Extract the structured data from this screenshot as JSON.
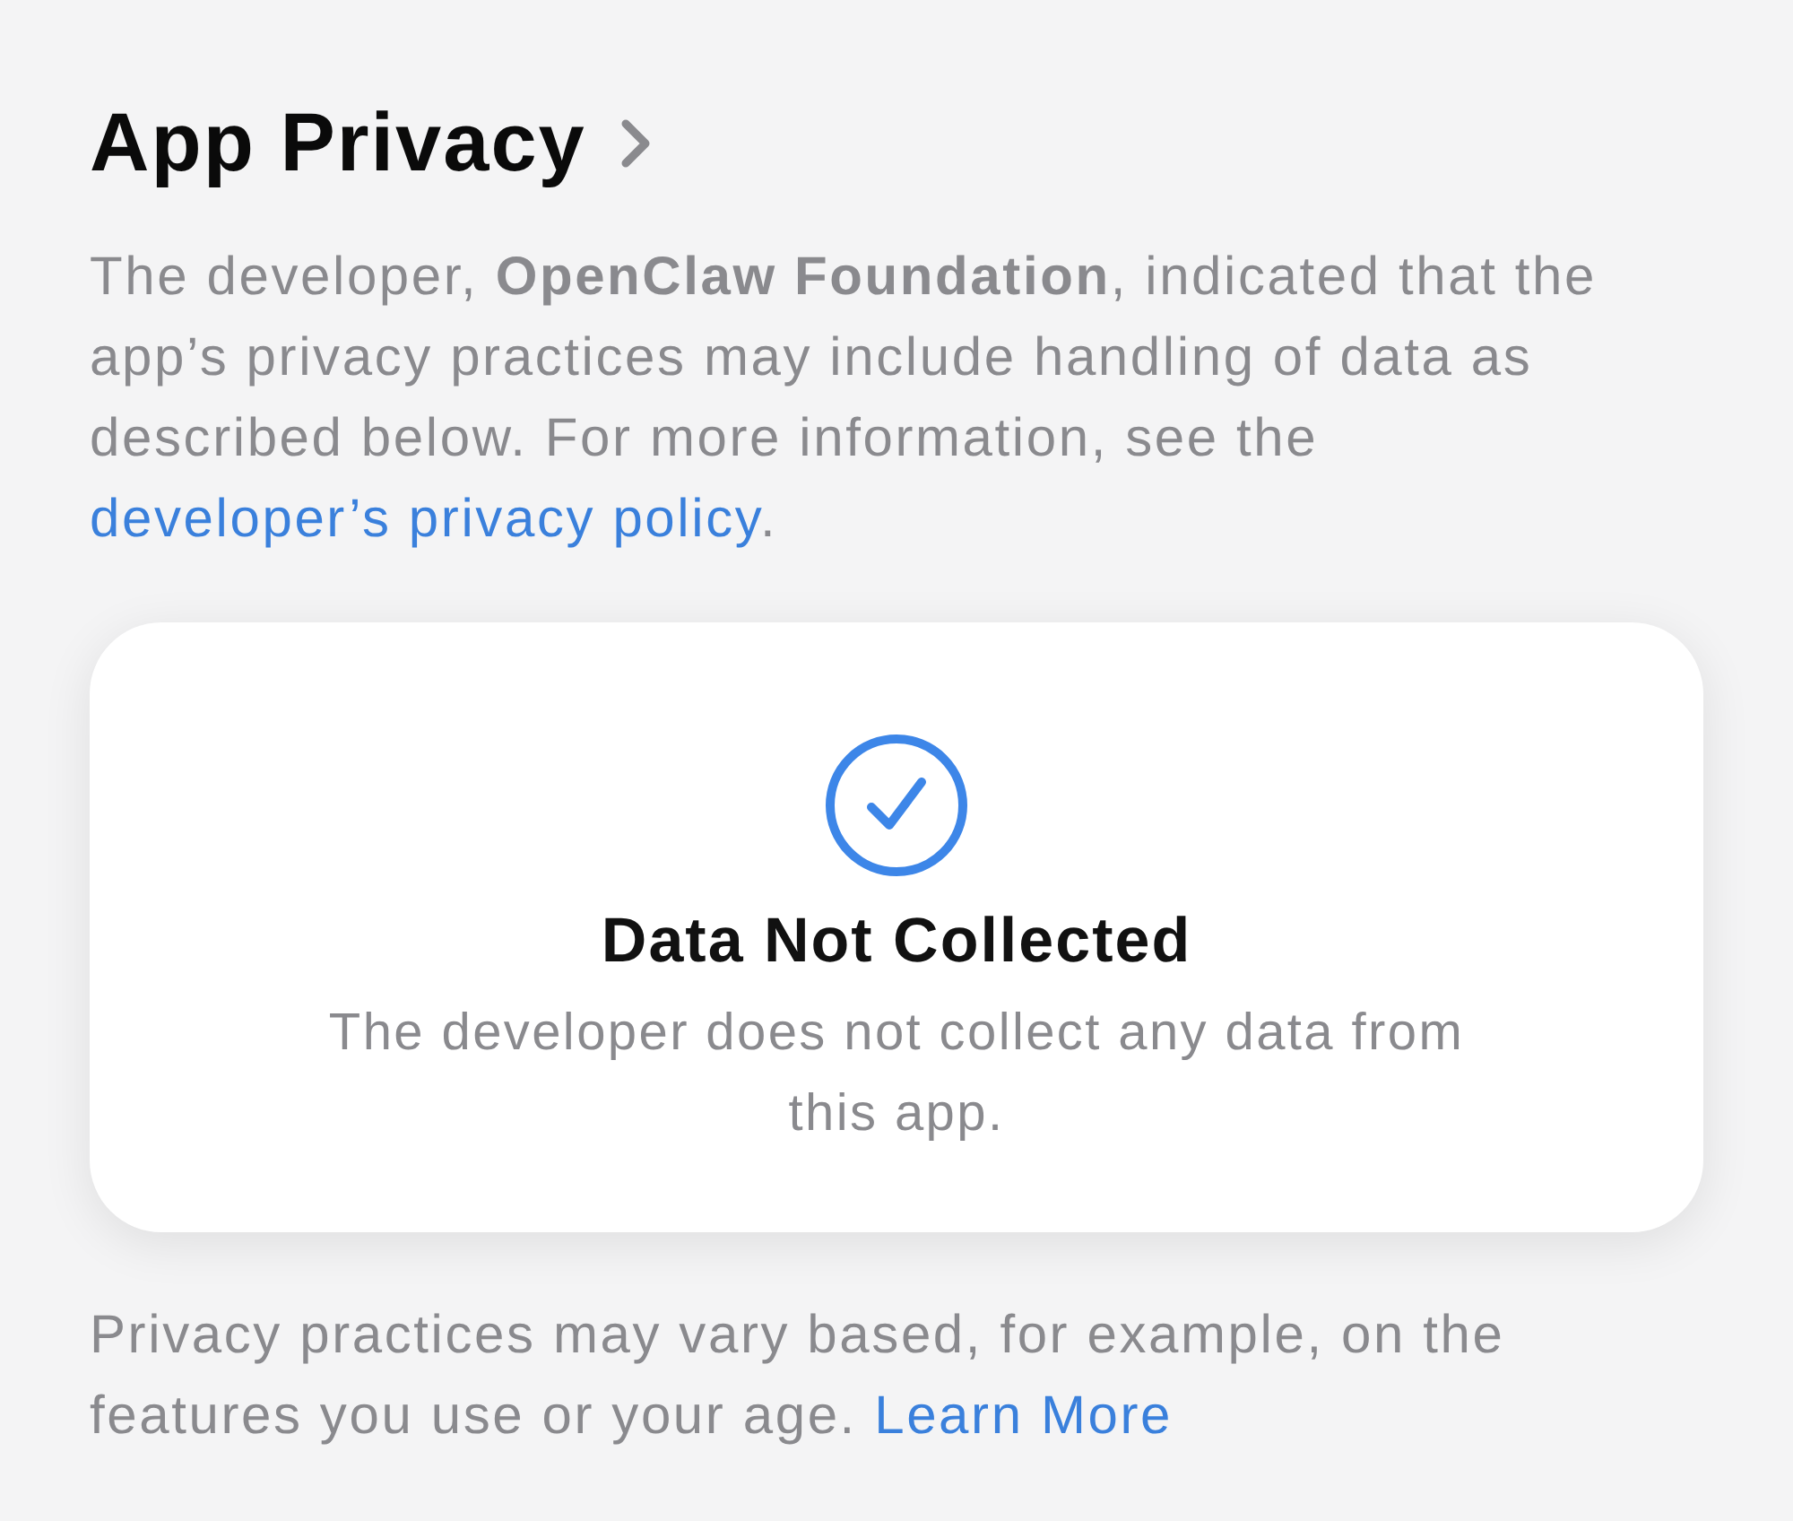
{
  "header": {
    "title": "App Privacy"
  },
  "intro": {
    "text": "The developer, **OpenClaw Foundation**, indicated that the app’s privacy practices may include handling of data as described below. For more information, see the",
    "link": "developer’s privacy policy",
    "after_link": "."
  },
  "card": {
    "title": "Data Not Collected",
    "description": "The developer does not collect any data from this app."
  },
  "footer": {
    "text": "Privacy practices may vary based, for example, on the features you use or your age.",
    "link": "Learn More"
  }
}
